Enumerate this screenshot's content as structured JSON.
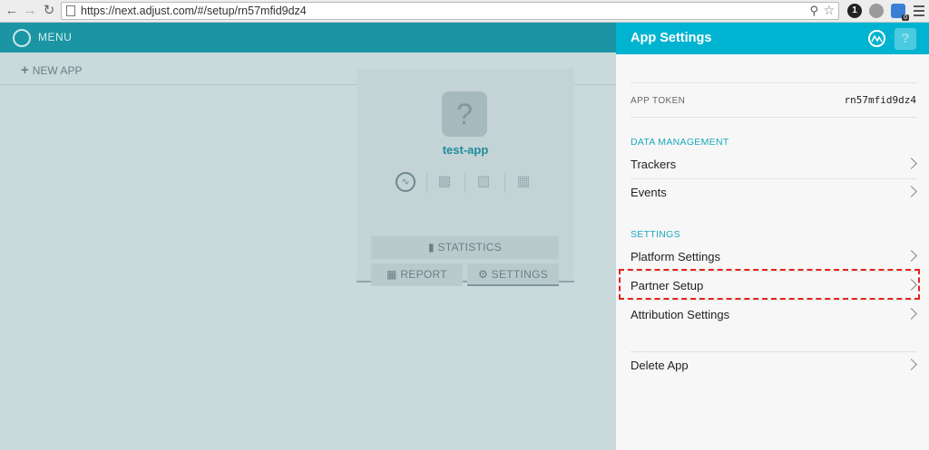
{
  "browser": {
    "url": "https://next.adjust.com/#/setup/rn57mfid9dz4",
    "extension_badge": "1",
    "extension_count": "0"
  },
  "app": {
    "menu_label": "MENU",
    "new_app_label": "NEW APP",
    "card": {
      "icon_glyph": "?",
      "app_name": "test-app",
      "platforms": [
        "appstore-icon",
        "android-icon",
        "windows-phone-icon",
        "windows-icon"
      ],
      "statistics_label": "STATISTICS",
      "report_label": "REPORT",
      "settings_label": "SETTINGS"
    }
  },
  "panel": {
    "title": "App Settings",
    "help_glyph": "?",
    "app_token_label": "APP TOKEN",
    "app_token_value": "rn57mfid9dz4",
    "data_management": {
      "label": "DATA MANAGEMENT",
      "items": [
        "Trackers",
        "Events"
      ]
    },
    "settings": {
      "label": "SETTINGS",
      "items": [
        "Platform Settings",
        "Partner Setup",
        "Attribution Settings"
      ]
    },
    "delete_label": "Delete App"
  },
  "colors": {
    "header": "#00b3d0",
    "section": "#19a9bf",
    "highlight": "#e2241a"
  }
}
